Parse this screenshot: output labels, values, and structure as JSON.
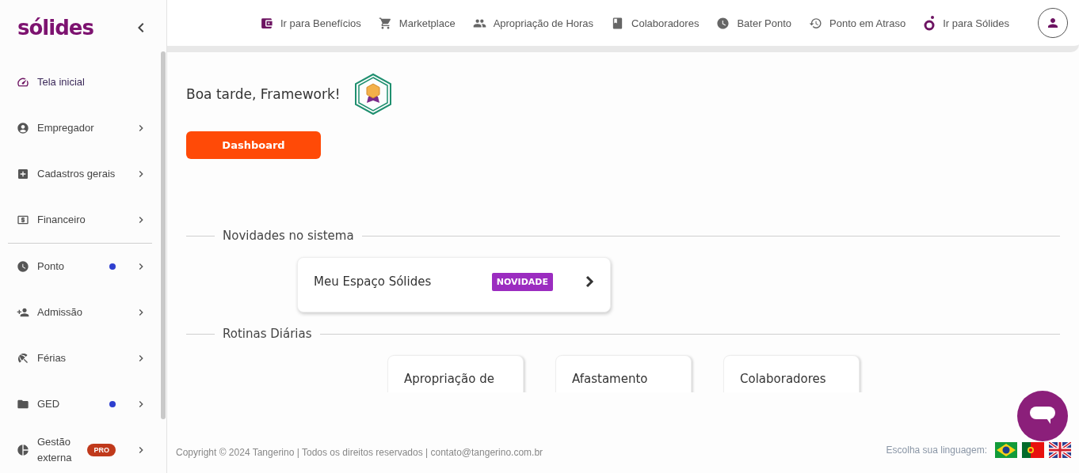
{
  "sidebar": {
    "logo": "sólides",
    "groups": [
      {
        "items": [
          {
            "label": "Tela inicial",
            "selected": true,
            "dot": false,
            "has_children": false
          },
          {
            "label": "Empregador",
            "selected": false,
            "dot": false,
            "has_children": true
          },
          {
            "label": "Cadastros gerais",
            "selected": false,
            "dot": false,
            "has_children": true
          },
          {
            "label": "Financeiro",
            "selected": false,
            "dot": false,
            "has_children": true
          }
        ]
      },
      {
        "items": [
          {
            "label": "Ponto",
            "selected": false,
            "dot": true,
            "has_children": true
          },
          {
            "label": "Admissão",
            "selected": false,
            "dot": false,
            "has_children": true
          },
          {
            "label": "Férias",
            "selected": false,
            "dot": false,
            "has_children": true
          },
          {
            "label": "GED",
            "selected": false,
            "dot": true,
            "has_children": true
          },
          {
            "label": "Gestão externa",
            "selected": false,
            "dot": false,
            "badge": "PRO",
            "has_children": true
          }
        ]
      }
    ]
  },
  "top_nav": [
    {
      "label": "Ir para Benefícios"
    },
    {
      "label": "Marketplace"
    },
    {
      "label": "Apropriação de Horas"
    },
    {
      "label": "Colaboradores"
    },
    {
      "label": "Bater Ponto"
    },
    {
      "label": "Ponto em Atraso"
    },
    {
      "label": "Ir para Sólides"
    }
  ],
  "content": {
    "greeting": "Boa tarde, Framework!",
    "primary_button": "Dashboard",
    "sections": [
      {
        "title": "Novidades no sistema",
        "kind": "feature",
        "cards": [
          {
            "title": "Meu Espaço Sólides",
            "badge": "NOVIDADE"
          }
        ]
      },
      {
        "title": "Rotinas Diárias",
        "kind": "tile",
        "cards": [
          {
            "title": "Apropriação de"
          },
          {
            "title": "Afastamento"
          },
          {
            "title": "Colaboradores"
          }
        ]
      }
    ]
  },
  "footer": {
    "copyright": "Copyright © 2024 Tangerino | Todos os direitos reservados | contato@tangerino.com.br",
    "language_label": "Escolha sua linguagem:"
  }
}
